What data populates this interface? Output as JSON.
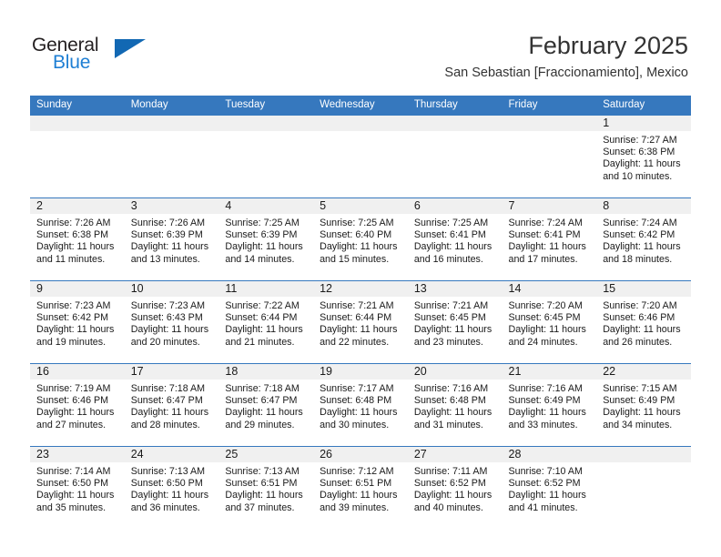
{
  "brand": {
    "name_part1": "General",
    "name_part2": "Blue",
    "accent_color": "#1268b3",
    "text_color": "#231f20"
  },
  "header": {
    "title": "February 2025",
    "subtitle": "San Sebastian [Fraccionamiento], Mexico"
  },
  "calendar": {
    "header_bg": "#3678be",
    "daynum_bg": "#f0f0f0",
    "weekdays": [
      "Sunday",
      "Monday",
      "Tuesday",
      "Wednesday",
      "Thursday",
      "Friday",
      "Saturday"
    ],
    "weeks": [
      [
        {
          "day": "",
          "lines": []
        },
        {
          "day": "",
          "lines": []
        },
        {
          "day": "",
          "lines": []
        },
        {
          "day": "",
          "lines": []
        },
        {
          "day": "",
          "lines": []
        },
        {
          "day": "",
          "lines": []
        },
        {
          "day": "1",
          "lines": [
            "Sunrise: 7:27 AM",
            "Sunset: 6:38 PM",
            "Daylight: 11 hours",
            "and 10 minutes."
          ]
        }
      ],
      [
        {
          "day": "2",
          "lines": [
            "Sunrise: 7:26 AM",
            "Sunset: 6:38 PM",
            "Daylight: 11 hours",
            "and 11 minutes."
          ]
        },
        {
          "day": "3",
          "lines": [
            "Sunrise: 7:26 AM",
            "Sunset: 6:39 PM",
            "Daylight: 11 hours",
            "and 13 minutes."
          ]
        },
        {
          "day": "4",
          "lines": [
            "Sunrise: 7:25 AM",
            "Sunset: 6:39 PM",
            "Daylight: 11 hours",
            "and 14 minutes."
          ]
        },
        {
          "day": "5",
          "lines": [
            "Sunrise: 7:25 AM",
            "Sunset: 6:40 PM",
            "Daylight: 11 hours",
            "and 15 minutes."
          ]
        },
        {
          "day": "6",
          "lines": [
            "Sunrise: 7:25 AM",
            "Sunset: 6:41 PM",
            "Daylight: 11 hours",
            "and 16 minutes."
          ]
        },
        {
          "day": "7",
          "lines": [
            "Sunrise: 7:24 AM",
            "Sunset: 6:41 PM",
            "Daylight: 11 hours",
            "and 17 minutes."
          ]
        },
        {
          "day": "8",
          "lines": [
            "Sunrise: 7:24 AM",
            "Sunset: 6:42 PM",
            "Daylight: 11 hours",
            "and 18 minutes."
          ]
        }
      ],
      [
        {
          "day": "9",
          "lines": [
            "Sunrise: 7:23 AM",
            "Sunset: 6:42 PM",
            "Daylight: 11 hours",
            "and 19 minutes."
          ]
        },
        {
          "day": "10",
          "lines": [
            "Sunrise: 7:23 AM",
            "Sunset: 6:43 PM",
            "Daylight: 11 hours",
            "and 20 minutes."
          ]
        },
        {
          "day": "11",
          "lines": [
            "Sunrise: 7:22 AM",
            "Sunset: 6:44 PM",
            "Daylight: 11 hours",
            "and 21 minutes."
          ]
        },
        {
          "day": "12",
          "lines": [
            "Sunrise: 7:21 AM",
            "Sunset: 6:44 PM",
            "Daylight: 11 hours",
            "and 22 minutes."
          ]
        },
        {
          "day": "13",
          "lines": [
            "Sunrise: 7:21 AM",
            "Sunset: 6:45 PM",
            "Daylight: 11 hours",
            "and 23 minutes."
          ]
        },
        {
          "day": "14",
          "lines": [
            "Sunrise: 7:20 AM",
            "Sunset: 6:45 PM",
            "Daylight: 11 hours",
            "and 24 minutes."
          ]
        },
        {
          "day": "15",
          "lines": [
            "Sunrise: 7:20 AM",
            "Sunset: 6:46 PM",
            "Daylight: 11 hours",
            "and 26 minutes."
          ]
        }
      ],
      [
        {
          "day": "16",
          "lines": [
            "Sunrise: 7:19 AM",
            "Sunset: 6:46 PM",
            "Daylight: 11 hours",
            "and 27 minutes."
          ]
        },
        {
          "day": "17",
          "lines": [
            "Sunrise: 7:18 AM",
            "Sunset: 6:47 PM",
            "Daylight: 11 hours",
            "and 28 minutes."
          ]
        },
        {
          "day": "18",
          "lines": [
            "Sunrise: 7:18 AM",
            "Sunset: 6:47 PM",
            "Daylight: 11 hours",
            "and 29 minutes."
          ]
        },
        {
          "day": "19",
          "lines": [
            "Sunrise: 7:17 AM",
            "Sunset: 6:48 PM",
            "Daylight: 11 hours",
            "and 30 minutes."
          ]
        },
        {
          "day": "20",
          "lines": [
            "Sunrise: 7:16 AM",
            "Sunset: 6:48 PM",
            "Daylight: 11 hours",
            "and 31 minutes."
          ]
        },
        {
          "day": "21",
          "lines": [
            "Sunrise: 7:16 AM",
            "Sunset: 6:49 PM",
            "Daylight: 11 hours",
            "and 33 minutes."
          ]
        },
        {
          "day": "22",
          "lines": [
            "Sunrise: 7:15 AM",
            "Sunset: 6:49 PM",
            "Daylight: 11 hours",
            "and 34 minutes."
          ]
        }
      ],
      [
        {
          "day": "23",
          "lines": [
            "Sunrise: 7:14 AM",
            "Sunset: 6:50 PM",
            "Daylight: 11 hours",
            "and 35 minutes."
          ]
        },
        {
          "day": "24",
          "lines": [
            "Sunrise: 7:13 AM",
            "Sunset: 6:50 PM",
            "Daylight: 11 hours",
            "and 36 minutes."
          ]
        },
        {
          "day": "25",
          "lines": [
            "Sunrise: 7:13 AM",
            "Sunset: 6:51 PM",
            "Daylight: 11 hours",
            "and 37 minutes."
          ]
        },
        {
          "day": "26",
          "lines": [
            "Sunrise: 7:12 AM",
            "Sunset: 6:51 PM",
            "Daylight: 11 hours",
            "and 39 minutes."
          ]
        },
        {
          "day": "27",
          "lines": [
            "Sunrise: 7:11 AM",
            "Sunset: 6:52 PM",
            "Daylight: 11 hours",
            "and 40 minutes."
          ]
        },
        {
          "day": "28",
          "lines": [
            "Sunrise: 7:10 AM",
            "Sunset: 6:52 PM",
            "Daylight: 11 hours",
            "and 41 minutes."
          ]
        },
        {
          "day": "",
          "lines": []
        }
      ]
    ]
  }
}
